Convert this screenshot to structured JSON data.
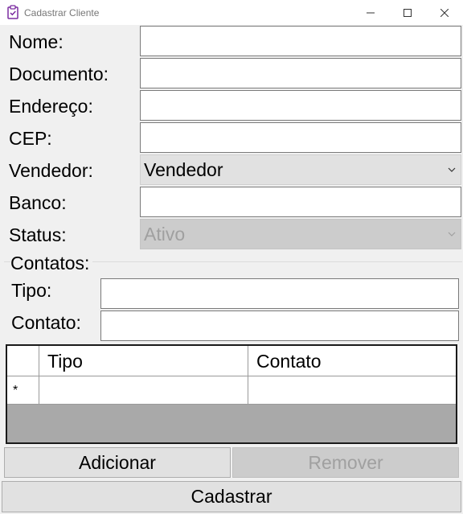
{
  "window": {
    "title": "Cadastrar Cliente"
  },
  "form": {
    "nome_label": "Nome:",
    "nome_value": "",
    "documento_label": "Documento:",
    "documento_value": "",
    "endereco_label": "Endereço:",
    "endereco_value": "",
    "cep_label": "CEP:",
    "cep_value": "",
    "vendedor_label": "Vendedor:",
    "vendedor_selected": "Vendedor",
    "banco_label": "Banco:",
    "banco_value": "",
    "status_label": "Status:",
    "status_selected": "Ativo"
  },
  "contatos": {
    "group_label": "Contatos:",
    "tipo_label": "Tipo:",
    "tipo_value": "",
    "contato_label": "Contato:",
    "contato_value": ""
  },
  "grid": {
    "columns": [
      "Tipo",
      "Contato"
    ],
    "new_row_marker": "*"
  },
  "buttons": {
    "adicionar": "Adicionar",
    "remover": "Remover",
    "cadastrar": "Cadastrar"
  }
}
